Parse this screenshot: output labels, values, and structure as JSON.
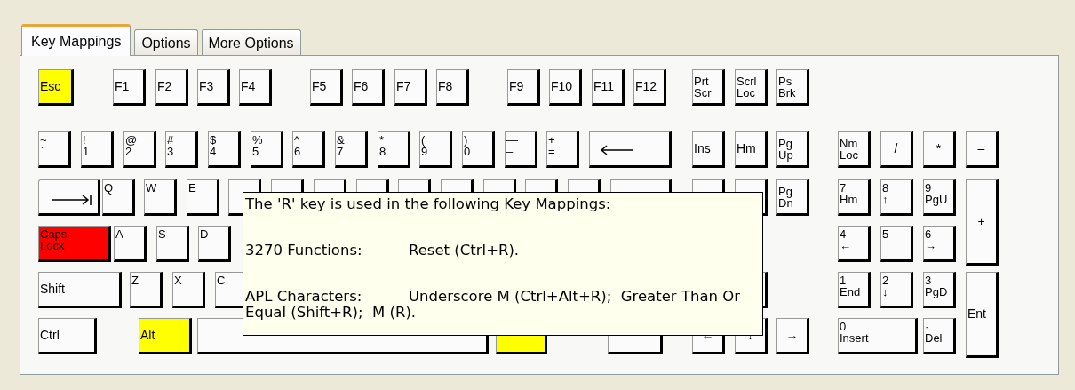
{
  "tabs": [
    {
      "label": "Key Mappings",
      "selected": true
    },
    {
      "label": "Options",
      "selected": false
    },
    {
      "label": "More Options",
      "selected": false
    }
  ],
  "keyboard": {
    "rows": [
      {
        "keys": [
          {
            "kind": "key",
            "legend": [
              "Esc"
            ],
            "color": "#ffff00"
          },
          {
            "kind": "key",
            "legend": [
              "F1"
            ]
          },
          {
            "kind": "key",
            "legend": [
              "F2"
            ]
          },
          {
            "kind": "key",
            "legend": [
              "F3"
            ]
          },
          {
            "kind": "key",
            "legend": [
              "F4"
            ]
          },
          {
            "kind": "key",
            "legend": [
              "F5"
            ]
          },
          {
            "kind": "key",
            "legend": [
              "F6"
            ]
          },
          {
            "kind": "key",
            "legend": [
              "F7"
            ]
          },
          {
            "kind": "key",
            "legend": [
              "F8"
            ]
          },
          {
            "kind": "key",
            "legend": [
              "F9"
            ]
          },
          {
            "kind": "key",
            "legend": [
              "F10"
            ]
          },
          {
            "kind": "key",
            "legend": [
              "F11"
            ]
          },
          {
            "kind": "key",
            "legend": [
              "F12"
            ]
          },
          {
            "kind": "key",
            "legend": [
              "Prt",
              "Scr"
            ]
          },
          {
            "kind": "key",
            "legend": [
              "Scrl",
              "Loc"
            ]
          },
          {
            "kind": "key",
            "legend": [
              "Ps",
              "Brk"
            ]
          }
        ]
      },
      {
        "keys": [
          {
            "kind": "letter",
            "legend": [
              "~",
              "`"
            ]
          },
          {
            "kind": "letter",
            "legend": [
              "!",
              "1"
            ]
          },
          {
            "kind": "letter",
            "legend": [
              "@",
              "2"
            ]
          },
          {
            "kind": "letter",
            "legend": [
              "#",
              "3"
            ]
          },
          {
            "kind": "letter",
            "legend": [
              "$",
              "4"
            ]
          },
          {
            "kind": "letter",
            "legend": [
              "%",
              "5"
            ]
          },
          {
            "kind": "letter",
            "legend": [
              "^",
              "6"
            ]
          },
          {
            "kind": "letter",
            "legend": [
              "&",
              "7"
            ]
          },
          {
            "kind": "letter",
            "legend": [
              "*",
              "8"
            ]
          },
          {
            "kind": "letter",
            "legend": [
              "(",
              "9"
            ]
          },
          {
            "kind": "letter",
            "legend": [
              ")",
              "0"
            ]
          },
          {
            "kind": "letter",
            "legend": [
              "—",
              "–"
            ]
          },
          {
            "kind": "letter",
            "legend": [
              "+",
              "="
            ]
          },
          {
            "kind": "backspace"
          },
          {
            "kind": "key",
            "legend": [
              "Ins"
            ]
          },
          {
            "kind": "key",
            "legend": [
              "Hm"
            ]
          },
          {
            "kind": "key",
            "legend": [
              "Pg",
              "Up"
            ]
          },
          {
            "kind": "key",
            "legend": [
              "Nm",
              "Loc"
            ]
          },
          {
            "kind": "symbol",
            "legend": [
              "/"
            ]
          },
          {
            "kind": "symbol",
            "legend": [
              "*"
            ]
          },
          {
            "kind": "symbol",
            "legend": [
              "–"
            ]
          }
        ]
      },
      {
        "keys": [
          {
            "kind": "tab"
          },
          {
            "kind": "letter",
            "legend": [
              "Q"
            ]
          },
          {
            "kind": "letter",
            "legend": [
              "W"
            ]
          },
          {
            "kind": "letter",
            "legend": [
              "E"
            ]
          },
          {
            "kind": "letter"
          },
          {
            "kind": "letter"
          },
          {
            "kind": "letter"
          },
          {
            "kind": "letter"
          },
          {
            "kind": "letter"
          },
          {
            "kind": "letter"
          },
          {
            "kind": "letter"
          },
          {
            "kind": "letter"
          },
          {
            "kind": "letter"
          },
          {
            "kind": "letter"
          },
          {
            "kind": "key"
          },
          {
            "kind": "key"
          },
          {
            "kind": "key",
            "legend": [
              "Pg",
              "Dn"
            ]
          },
          {
            "kind": "letter",
            "legend": [
              "7",
              "Hm"
            ]
          },
          {
            "kind": "letter",
            "legend": [
              "8",
              "↑"
            ]
          },
          {
            "kind": "letter",
            "legend": [
              "9",
              "PgU"
            ]
          },
          {
            "kind": "symbol",
            "legend": [
              "+"
            ]
          }
        ]
      },
      {
        "keys": [
          {
            "kind": "letter",
            "legend": [
              "Caps",
              "Lock"
            ],
            "color": "#ff0000"
          },
          {
            "kind": "letter",
            "legend": [
              "A"
            ]
          },
          {
            "kind": "letter",
            "legend": [
              "S"
            ]
          },
          {
            "kind": "letter",
            "legend": [
              "D"
            ]
          },
          {
            "kind": "letter",
            "legend": [
              "4",
              "←"
            ]
          },
          {
            "kind": "letter",
            "legend": [
              "5"
            ]
          },
          {
            "kind": "letter",
            "legend": [
              "6",
              "→"
            ]
          }
        ]
      },
      {
        "keys": [
          {
            "kind": "key",
            "legend": [
              "Shift"
            ]
          },
          {
            "kind": "letter",
            "legend": [
              "Z"
            ]
          },
          {
            "kind": "letter",
            "legend": [
              "X"
            ]
          },
          {
            "kind": "letter",
            "legend": [
              "C"
            ]
          },
          {
            "kind": "key"
          },
          {
            "kind": "letter",
            "legend": [
              "1",
              "End"
            ]
          },
          {
            "kind": "letter",
            "legend": [
              "2",
              "↓"
            ]
          },
          {
            "kind": "letter",
            "legend": [
              "3",
              "PgD"
            ]
          },
          {
            "kind": "key",
            "legend": [
              "Ent"
            ]
          }
        ]
      },
      {
        "keys": [
          {
            "kind": "key",
            "legend": [
              "Ctrl"
            ]
          },
          {
            "kind": "key",
            "legend": [
              "Alt"
            ],
            "color": "#ffff00"
          },
          {
            "kind": "key"
          },
          {
            "kind": "key",
            "color": "#ffff00"
          },
          {
            "kind": "key"
          },
          {
            "kind": "symbol",
            "legend": [
              "←"
            ]
          },
          {
            "kind": "symbol",
            "legend": [
              "↓"
            ]
          },
          {
            "kind": "symbol",
            "legend": [
              "→"
            ]
          },
          {
            "kind": "letter",
            "legend": [
              "0",
              "Insert"
            ]
          },
          {
            "kind": "letter",
            "legend": [
              "·",
              "Del"
            ]
          }
        ]
      }
    ]
  },
  "tooltip": {
    "heading": "The 'R' key is used in the following Key Mappings:",
    "entries": [
      {
        "label": "3270 Functions:",
        "value": "Reset (Ctrl+R)."
      },
      {
        "label": "APL Characters:",
        "value": "Underscore M (Ctrl+Alt+R);  Greater Than Or Equal (Shift+R);  M (R)."
      }
    ]
  }
}
